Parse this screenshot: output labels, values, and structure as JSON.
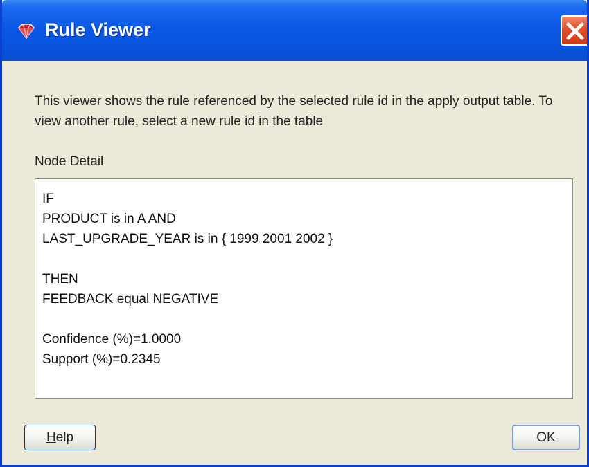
{
  "window": {
    "title": "Rule Viewer",
    "title_icon": "jewel-icon",
    "close_icon": "close-icon",
    "accent_color": "#0a58e6"
  },
  "main": {
    "description": "This viewer shows the rule referenced by the selected rule id in the apply output table.  To view another rule, select a new rule id in the table",
    "section_label": "Node Detail",
    "node_detail_lines": [
      "IF",
      "PRODUCT is in A AND",
      "LAST_UPGRADE_YEAR is in { 1999 2001 2002 }",
      "",
      "THEN",
      "FEEDBACK equal NEGATIVE",
      "",
      "Confidence (%)=1.0000",
      "Support (%)=0.2345"
    ]
  },
  "buttons": {
    "help_mnemonic": "H",
    "help_rest": "elp",
    "ok_label": "OK"
  }
}
